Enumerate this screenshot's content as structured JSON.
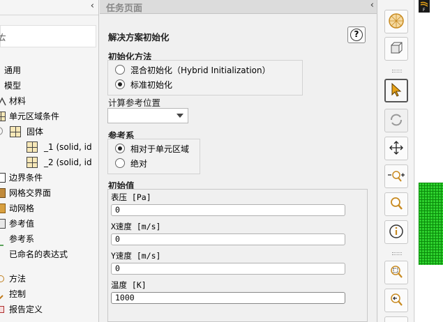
{
  "tree": {
    "filter_partial": "ㄊ",
    "items": [
      {
        "label": "通用"
      },
      {
        "label": "模型"
      },
      {
        "label": "材料"
      },
      {
        "label": "单元区域条件"
      },
      {
        "label": "固体"
      },
      {
        "label": "_1 (solid, id"
      },
      {
        "label": "_2 (solid, id"
      },
      {
        "label": "边界条件"
      },
      {
        "label": "网格交界面"
      },
      {
        "label": "动网格"
      },
      {
        "label": "参考值"
      },
      {
        "label": "参考系"
      },
      {
        "label": "已命名的表达式"
      },
      {
        "label": "方法"
      },
      {
        "label": "控制"
      },
      {
        "label": "报告定义"
      }
    ]
  },
  "task": {
    "header_title": "任务页面",
    "heading": "解决方案初始化",
    "help_glyph": "?",
    "init_method": {
      "title": "初始化方法",
      "options": [
        "混合初始化（Hybrid Initialization）",
        "标准初始化"
      ],
      "selected": "标准初始化"
    },
    "compute_from": {
      "title": "计算参考位置",
      "value": ""
    },
    "reference_frame": {
      "title": "参考系",
      "options": [
        "相对于单元区域",
        "绝对"
      ],
      "selected": "相对于单元区域"
    },
    "initial_values": {
      "title": "初始值",
      "fields": [
        {
          "label": "表压 [Pa]",
          "value": "0"
        },
        {
          "label": "X速度 [m/s]",
          "value": "0"
        },
        {
          "label": "Y速度 [m/s]",
          "value": "0"
        },
        {
          "label": "温度 [K]",
          "value": "1000"
        }
      ]
    }
  },
  "toolbar": {
    "buttons": [
      "sphere-mesh-icon",
      "box-view-icon",
      "pointer-arrow-icon",
      "rotate-icon",
      "pan-move-icon",
      "zoom-in-out-icon",
      "zoom-icon",
      "info-icon",
      "zoom-fit-icon",
      "zoom-previous-icon"
    ]
  },
  "colors": {
    "mesh_green": "#2ed12e",
    "pointer_orange": "#e8a317"
  }
}
